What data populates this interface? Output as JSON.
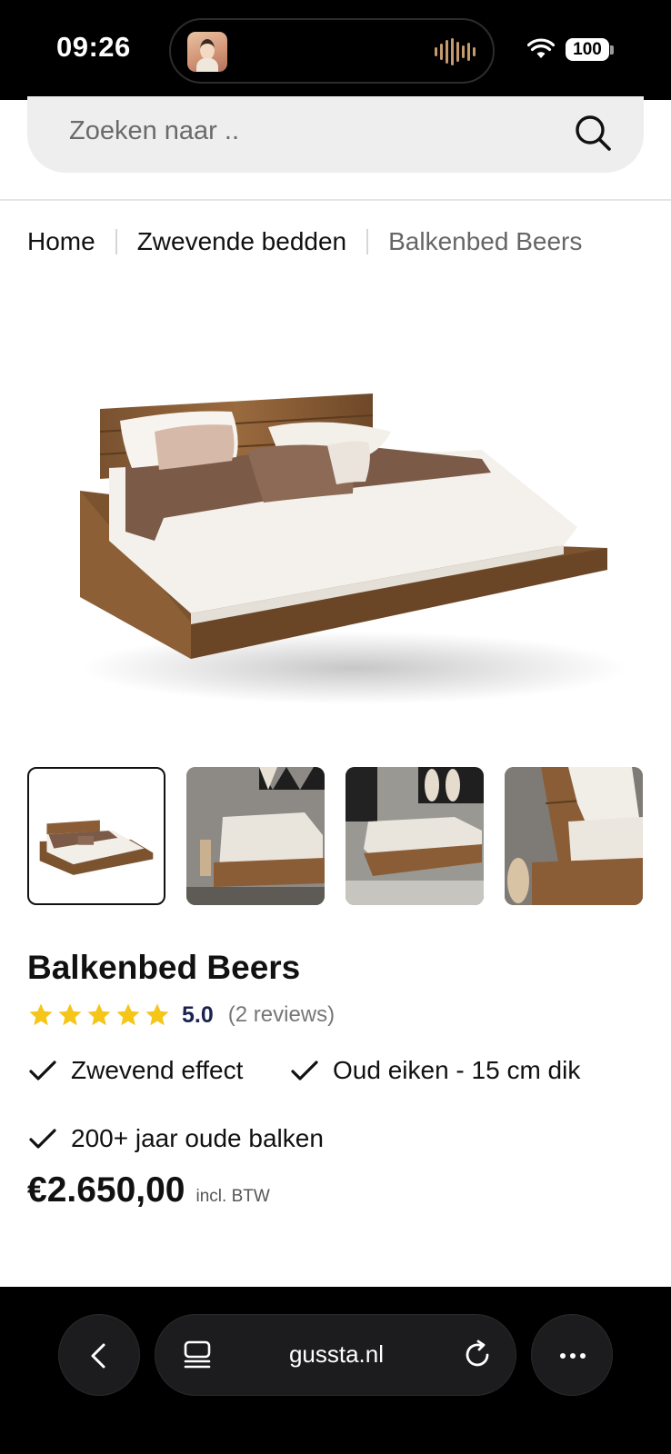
{
  "status_bar": {
    "time": "09:26",
    "battery": "100"
  },
  "search": {
    "placeholder": "Zoeken naar .."
  },
  "breadcrumb": [
    {
      "label": "Home"
    },
    {
      "label": "Zwevende bedden"
    },
    {
      "label": "Balkenbed Beers"
    }
  ],
  "gallery": {
    "main_image": "bed-product-image",
    "thumbnail_count": 4,
    "active_thumbnail": 1
  },
  "product": {
    "title": "Balkenbed Beers",
    "rating": {
      "stars": 5,
      "score": "5.0",
      "reviews": "(2 reviews)"
    },
    "usps": [
      "Zwevend effect",
      "Oud eiken - 15 cm dik",
      "200+ jaar oude balken"
    ],
    "price": "€2.650,00",
    "vat_note": "incl. BTW"
  },
  "browser": {
    "url": "gussta.nl"
  },
  "colors": {
    "star": "#f5c518",
    "score": "#1a2350",
    "text": "#111111",
    "bar": "#000000"
  }
}
